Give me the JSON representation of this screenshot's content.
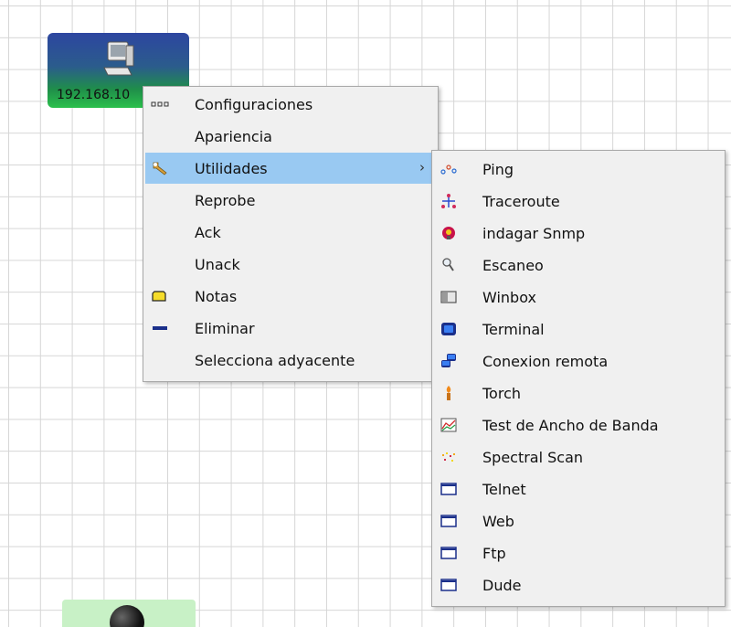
{
  "node": {
    "ip_label": "192.168.10"
  },
  "context_menu": {
    "items": [
      {
        "label": "Configuraciones",
        "icon": "ellipsis-icon"
      },
      {
        "label": "Apariencia",
        "icon": ""
      },
      {
        "label": "Utilidades",
        "icon": "wrench-icon",
        "highlighted": true,
        "has_submenu": true
      },
      {
        "label": "Reprobe",
        "icon": ""
      },
      {
        "label": "Ack",
        "icon": ""
      },
      {
        "label": "Unack",
        "icon": ""
      },
      {
        "label": "Notas",
        "icon": "note-icon"
      },
      {
        "label": "Eliminar",
        "icon": "minus-icon"
      },
      {
        "label": "Selecciona adyacente",
        "icon": ""
      }
    ],
    "submenu_arrow": "›"
  },
  "submenu": {
    "items": [
      {
        "label": "Ping",
        "icon": "ping-icon"
      },
      {
        "label": "Traceroute",
        "icon": "traceroute-icon"
      },
      {
        "label": "indagar Snmp",
        "icon": "snmp-icon"
      },
      {
        "label": "Escaneo",
        "icon": "magnifier-icon"
      },
      {
        "label": "Winbox",
        "icon": "winbox-icon"
      },
      {
        "label": "Terminal",
        "icon": "terminal-icon"
      },
      {
        "label": "Conexion remota",
        "icon": "remote-connection-icon"
      },
      {
        "label": "Torch",
        "icon": "torch-icon"
      },
      {
        "label": "Test de Ancho de Banda",
        "icon": "bandwidth-icon"
      },
      {
        "label": "Spectral Scan",
        "icon": "spectral-icon"
      },
      {
        "label": "Telnet",
        "icon": "window-icon"
      },
      {
        "label": "Web",
        "icon": "window-icon"
      },
      {
        "label": "Ftp",
        "icon": "window-icon"
      },
      {
        "label": "Dude",
        "icon": "window-icon"
      }
    ]
  },
  "colors": {
    "highlight": "#99c9f2",
    "menu_bg": "#f0f0f0"
  }
}
